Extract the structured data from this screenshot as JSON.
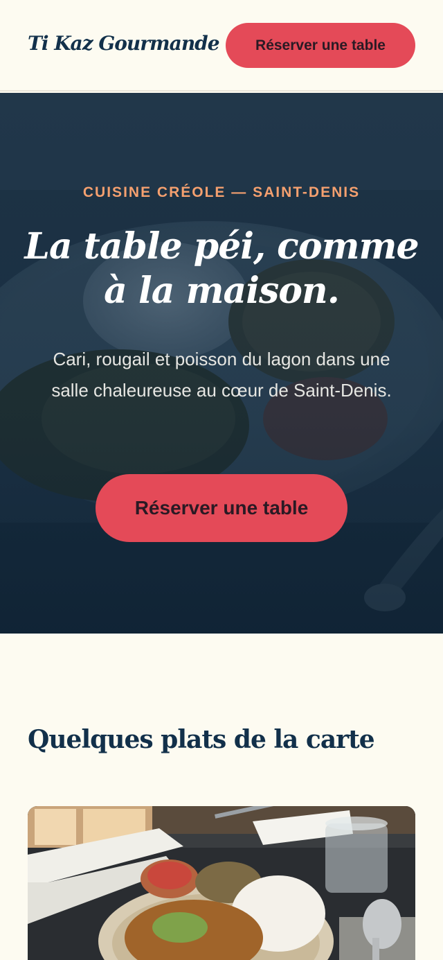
{
  "header": {
    "brand": "Ti Kaz Gourmande",
    "cta_label": "Réserver une table"
  },
  "hero": {
    "eyebrow": "CUISINE CRÉOLE — SAINT-DENIS",
    "title": "La table péi, comme à la maison.",
    "text": "Cari, rougail et poisson du lagon dans une salle chaleureuse au cœur de Saint-Denis.",
    "cta_label": "Réserver une table"
  },
  "menu": {
    "title": "Quelques plats de la carte"
  },
  "colors": {
    "accent": "#e44a58",
    "navy": "#12304a",
    "eyebrow": "#f4a06f",
    "background": "#fdfbf1"
  }
}
